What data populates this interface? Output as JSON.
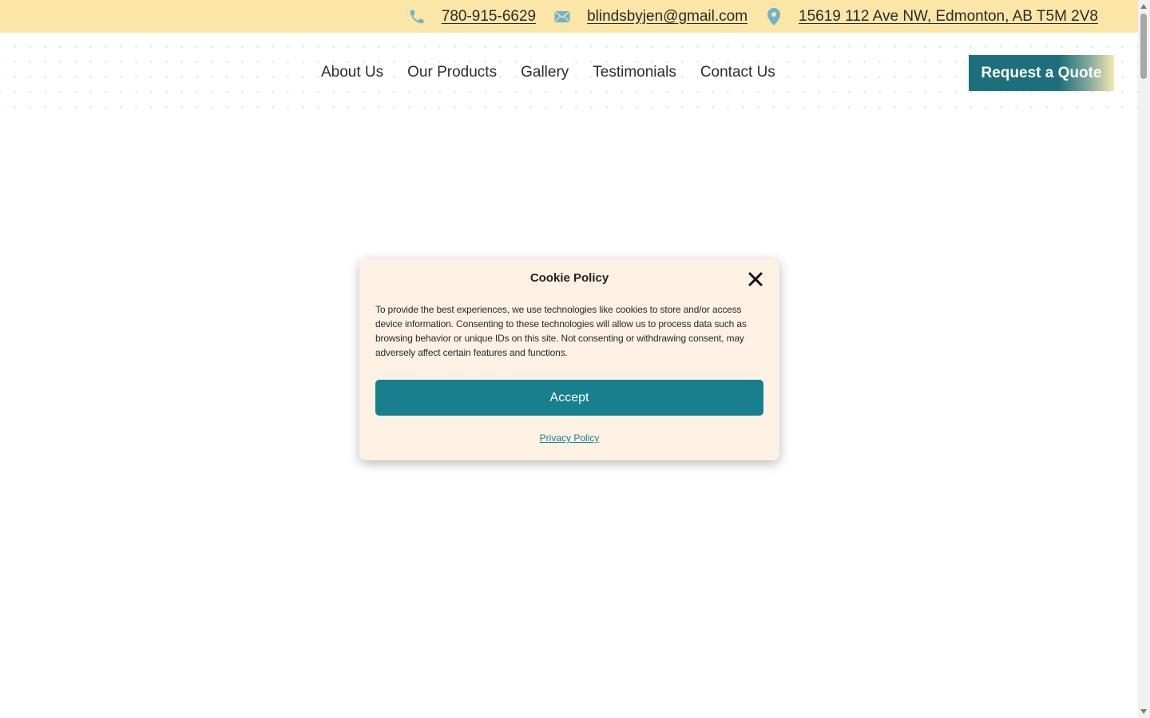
{
  "topbar": {
    "phone": "780-915-6629",
    "email": "blindsbyjen@gmail.com",
    "address": "15619 112 Ave NW, Edmonton, AB T5M 2V8",
    "icon_color": "#6fb3c9",
    "background": "#fbe6a7"
  },
  "nav": {
    "items": [
      {
        "label": "About Us"
      },
      {
        "label": "Our Products"
      },
      {
        "label": "Gallery"
      },
      {
        "label": "Testimonials"
      },
      {
        "label": "Contact Us"
      }
    ],
    "quote_button": "Request a Quote"
  },
  "cookie_modal": {
    "title": "Cookie Policy",
    "body": "To provide the best experiences, we use technologies like cookies to store and/or access device information. Consenting to these technologies will allow us to process data such as browsing behavior or unique IDs on this site. Not consenting or withdrawing consent, may adversely affect certain features and functions.",
    "accept_label": "Accept",
    "privacy_label": "Privacy Policy",
    "accent": "#177f8d",
    "background": "#fdf1e3"
  },
  "icons": {
    "phone": "phone-icon",
    "email": "envelope-icon",
    "location": "map-pin-icon",
    "close": "close-icon"
  }
}
